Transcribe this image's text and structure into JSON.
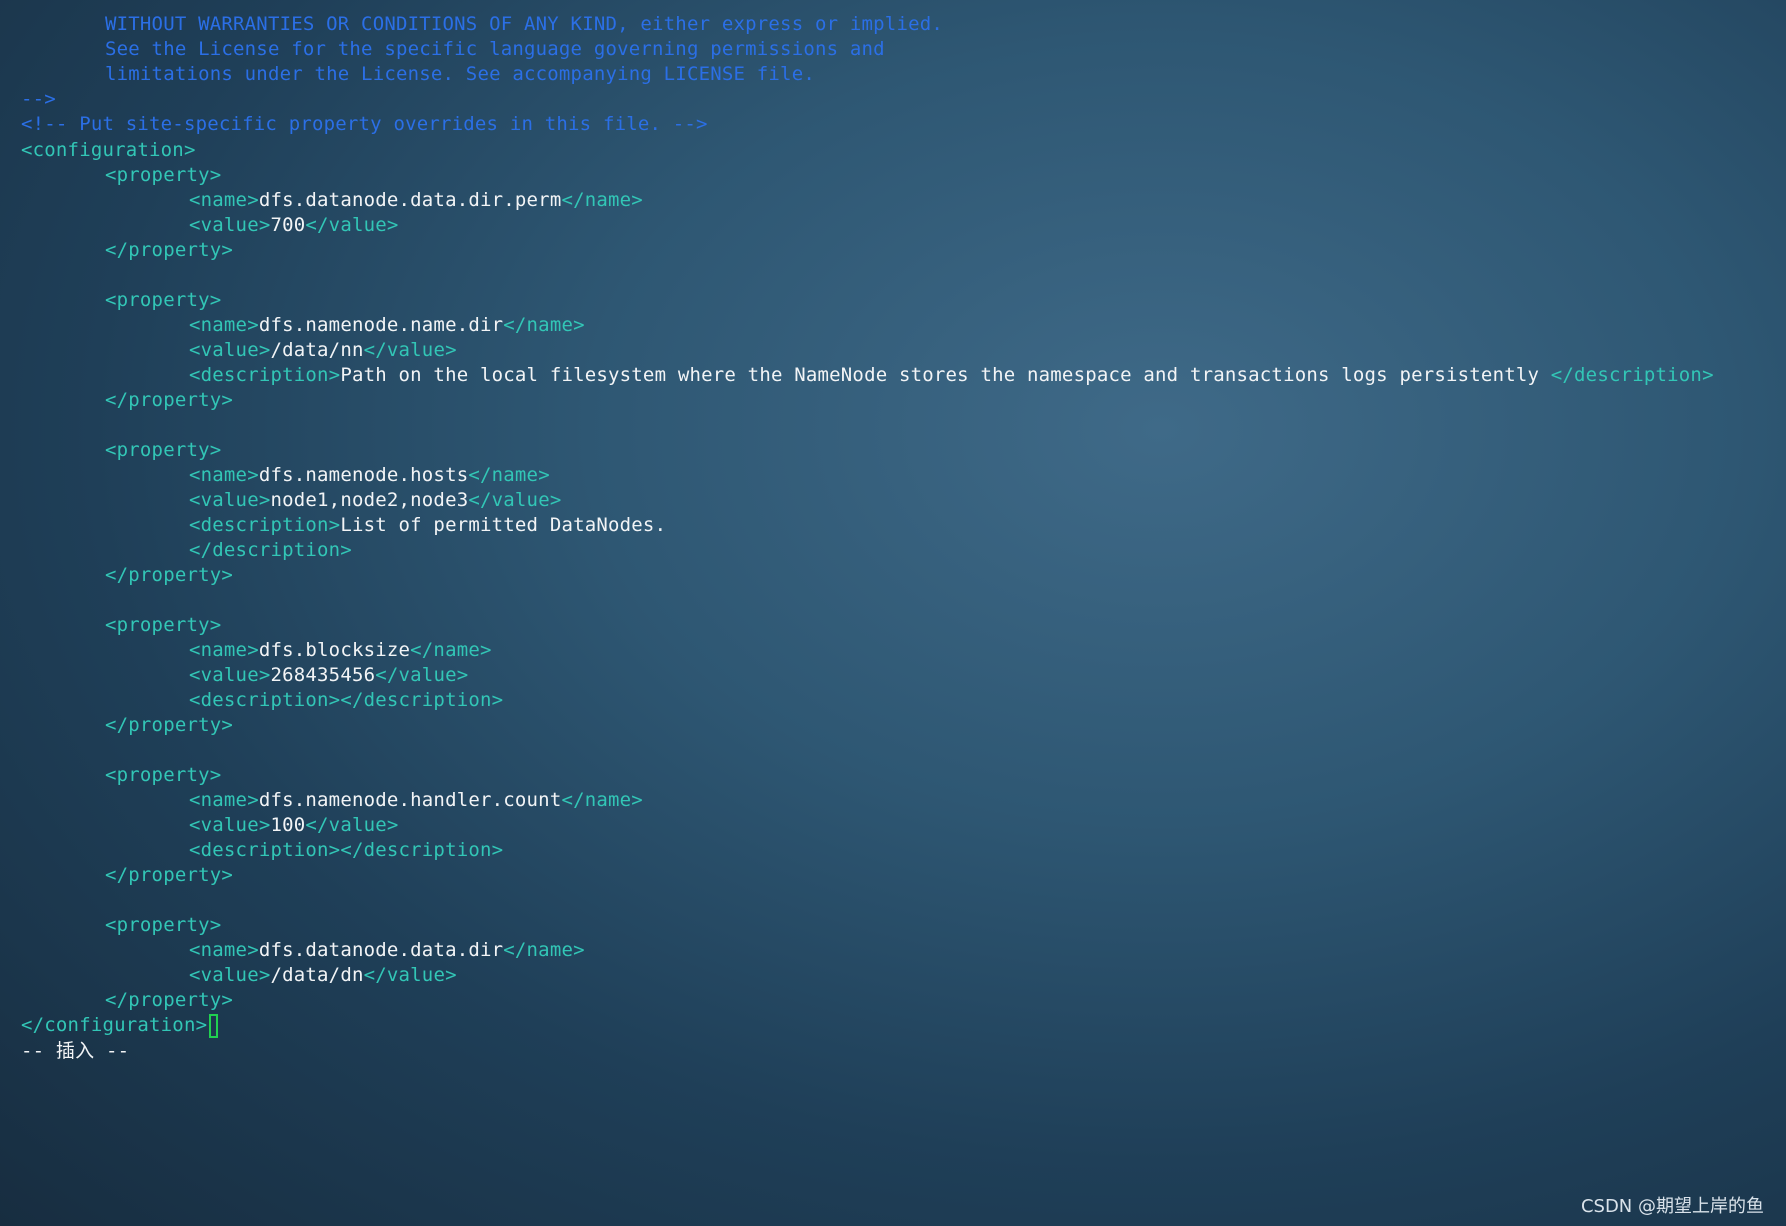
{
  "comments": {
    "line1": "WITHOUT WARRANTIES OR CONDITIONS OF ANY KIND, either express or implied.",
    "line2": "See the License for the specific language governing permissions and",
    "line3": "limitations under the License. See accompanying LICENSE file.",
    "close": "-->",
    "site": "<!-- Put site-specific property overrides in this file. -->"
  },
  "tags": {
    "configuration_open": "<configuration>",
    "configuration_close": "</configuration>",
    "property_open": "<property>",
    "property_close": "</property>",
    "name_open": "<name>",
    "name_close": "</name>",
    "value_open": "<value>",
    "value_close": "</value>",
    "description_open": "<description>",
    "description_close": "</description>"
  },
  "properties": [
    {
      "name": "dfs.datanode.data.dir.perm",
      "value": "700"
    },
    {
      "name": "dfs.namenode.name.dir",
      "value": "/data/nn",
      "description": "Path on the local filesystem where the NameNode stores the namespace and transactions logs persistently "
    },
    {
      "name": "dfs.namenode.hosts",
      "value": "node1,node2,node3",
      "description": "List of permitted DataNodes."
    },
    {
      "name": "dfs.blocksize",
      "value": "268435456",
      "description": ""
    },
    {
      "name": "dfs.namenode.handler.count",
      "value": "100",
      "description": ""
    },
    {
      "name": "dfs.datanode.data.dir",
      "value": "/data/dn"
    }
  ],
  "status": {
    "mode": "-- 插入 --"
  },
  "watermark": "CSDN @期望上岸的鱼"
}
